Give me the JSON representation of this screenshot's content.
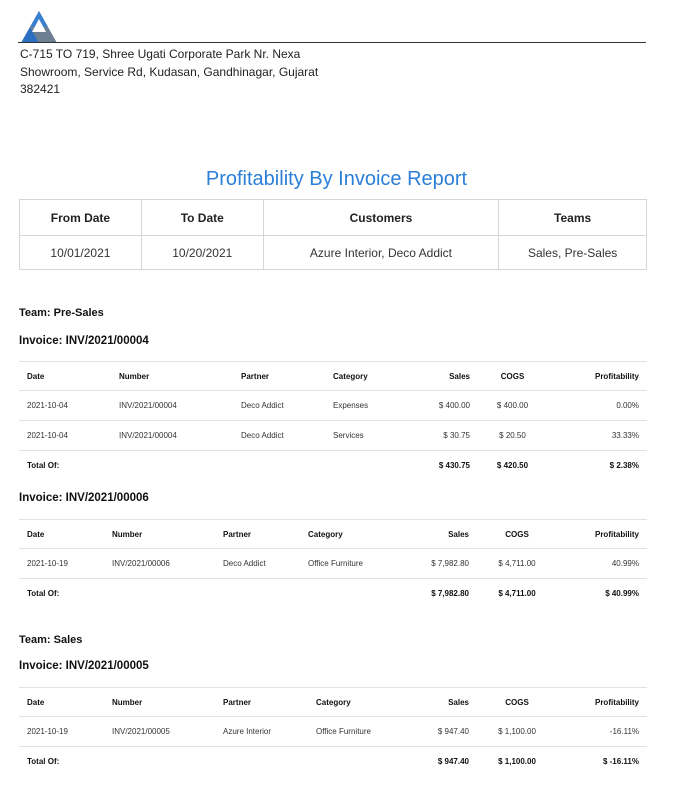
{
  "company": {
    "logo_icon": "triangle-logo-icon",
    "address_lines": [
      "C-715 TO 719, Shree Ugati Corporate Park Nr. Nexa",
      "Showroom, Service Rd, Kudasan, Gandhinagar, Gujarat",
      "382421"
    ]
  },
  "report": {
    "title": "Profitability By Invoice Report",
    "title_color": "#2b7fd8"
  },
  "summary": {
    "headers": [
      "From Date",
      "To Date",
      "Customers",
      "Teams"
    ],
    "values": [
      "10/01/2021",
      "10/20/2021",
      "Azure Interior, Deco Addict",
      "Sales, Pre-Sales"
    ]
  },
  "columns": [
    "Date",
    "Number",
    "Partner",
    "Category",
    "Sales",
    "COGS",
    "Profitability"
  ],
  "teams": [
    {
      "label": "Team: Pre-Sales",
      "invoices": [
        {
          "label": "Invoice: INV/2021/00004",
          "rows": [
            [
              "2021-10-04",
              "INV/2021/00004",
              "Deco Addict",
              "Expenses",
              "$ 400.00",
              "$ 400.00",
              "0.00%"
            ],
            [
              "2021-10-04",
              "INV/2021/00004",
              "Deco Addict",
              "Services",
              "$ 30.75",
              "$ 20.50",
              "33.33%"
            ]
          ],
          "total": {
            "label": "Total Of:",
            "sales": "$ 430.75",
            "cogs": "$ 420.50",
            "profitability": "$ 2.38%"
          }
        },
        {
          "label": "Invoice: INV/2021/00006",
          "rows": [
            [
              "2021-10-19",
              "INV/2021/00006",
              "Deco Addict",
              "Office Furniture",
              "$ 7,982.80",
              "$ 4,711.00",
              "40.99%"
            ]
          ],
          "total": {
            "label": "Total Of:",
            "sales": "$ 7,982.80",
            "cogs": "$ 4,711.00",
            "profitability": "$ 40.99%"
          }
        }
      ]
    },
    {
      "label": "Team: Sales",
      "invoices": [
        {
          "label": "Invoice: INV/2021/00005",
          "rows": [
            [
              "2021-10-19",
              "INV/2021/00005",
              "Azure Interior",
              "Office Furniture",
              "$ 947.40",
              "$ 1,100.00",
              "-16.11%"
            ]
          ],
          "total": {
            "label": "Total Of:",
            "sales": "$ 947.40",
            "cogs": "$ 1,100.00",
            "profitability": "$ -16.11%"
          }
        }
      ]
    }
  ]
}
